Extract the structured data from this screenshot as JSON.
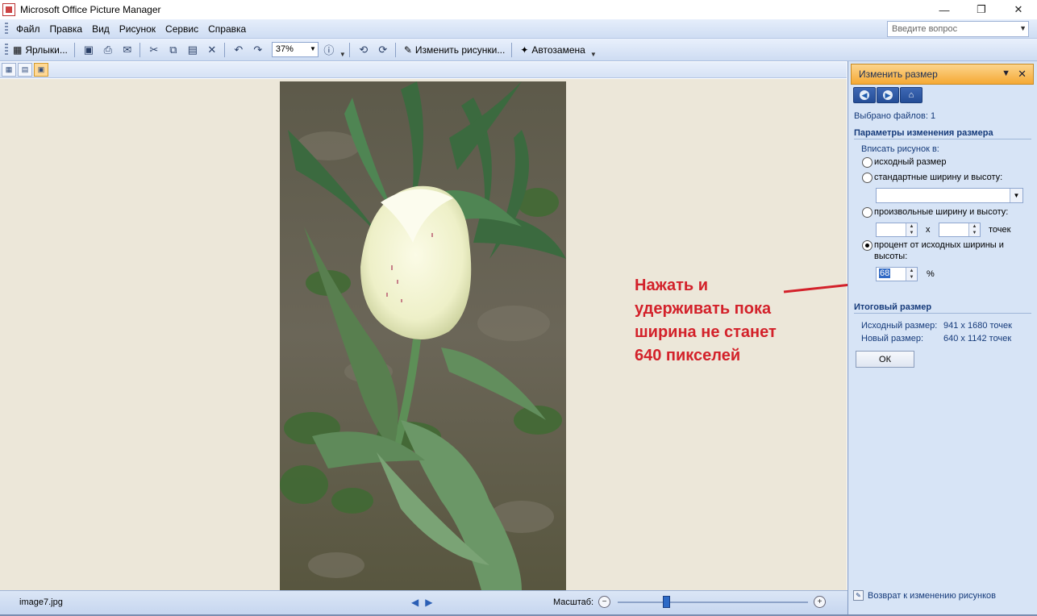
{
  "window": {
    "title": "Microsoft Office Picture Manager",
    "minimize": "—",
    "maximize": "❐",
    "close": "✕"
  },
  "menu": {
    "items": [
      "Файл",
      "Правка",
      "Вид",
      "Рисунок",
      "Сервис",
      "Справка"
    ],
    "ask_placeholder": "Введите вопрос"
  },
  "toolbar": {
    "shortcuts_label": "Ярлыки...",
    "zoom_value": "37%",
    "edit_pictures_label": "Изменить рисунки...",
    "autofix_label": "Автозамена"
  },
  "pane": {
    "title": "Изменить размер",
    "files_selected": "Выбрано файлов: 1",
    "params_heading": "Параметры изменения размера",
    "fit_label": "Вписать рисунок в:",
    "opt_original": "исходный размер",
    "opt_standard": "стандартные ширину и высоту:",
    "opt_custom": "произвольные ширину и высоту:",
    "custom_x": "x",
    "custom_unit": "точек",
    "opt_percent_line1": "процент от исходных ширины и",
    "opt_percent_line2": "высоты:",
    "percent_value": "68",
    "percent_unit": "%",
    "result_heading": "Итоговый размер",
    "original_label": "Исходный размер:",
    "original_value": "941 x 1680 точек",
    "new_label": "Новый размер:",
    "new_value": "640 x 1142 точек",
    "ok_label": "ОК",
    "footer_link": "Возврат к изменению рисунков"
  },
  "annotation": {
    "line1": "Нажать и",
    "line2": "удерживать пока",
    "line3": "ширина не станет",
    "line4": "640 пикселей",
    "color": "#d3212a"
  },
  "status": {
    "filename": "image7.jpg",
    "scale_label": "Масштаб:"
  },
  "colors": {
    "pane_header": "#f5a934",
    "pane_bg": "#d7e4f6",
    "canvas_bg": "#ece7d9"
  }
}
